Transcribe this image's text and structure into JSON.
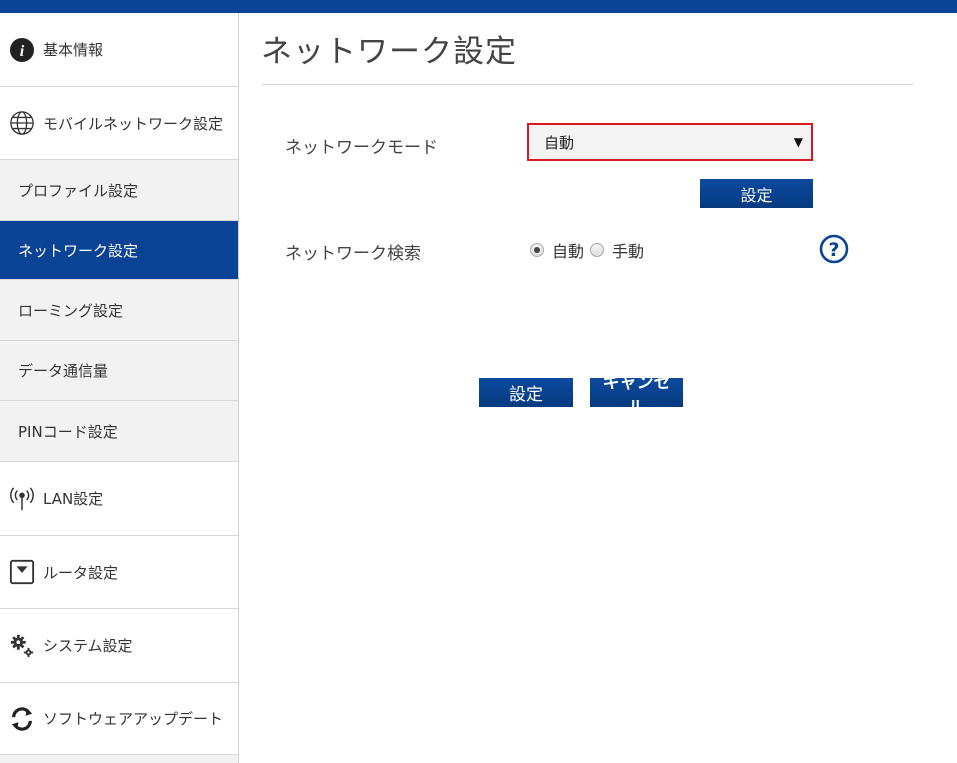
{
  "page": {
    "title": "ネットワーク設定"
  },
  "sidebar": {
    "items": [
      {
        "label": "基本情報",
        "icon": "info-icon"
      },
      {
        "label": "モバイルネットワーク設定",
        "icon": "globe-icon"
      },
      {
        "label": "プロファイル設定"
      },
      {
        "label": "ネットワーク設定",
        "active": true
      },
      {
        "label": "ローミング設定"
      },
      {
        "label": "データ通信量"
      },
      {
        "label": "PINコード設定"
      },
      {
        "label": "LAN設定",
        "icon": "antenna-icon"
      },
      {
        "label": "ルータ設定",
        "icon": "router-icon"
      },
      {
        "label": "システム設定",
        "icon": "gears-icon"
      },
      {
        "label": "ソフトウェアアップデート",
        "icon": "refresh-icon"
      }
    ]
  },
  "form": {
    "network_mode_label": "ネットワークモード",
    "network_mode_value": "自動",
    "set_button": "設定",
    "network_search_label": "ネットワーク検索",
    "search_options": [
      {
        "label": "自動",
        "selected": true
      },
      {
        "label": "手動",
        "selected": false
      }
    ],
    "help_symbol": "?"
  },
  "footer_buttons": {
    "save": "設定",
    "cancel": "キャンセル"
  },
  "colors": {
    "brand_blue": "#0a4395",
    "highlight_red": "#d71920"
  }
}
